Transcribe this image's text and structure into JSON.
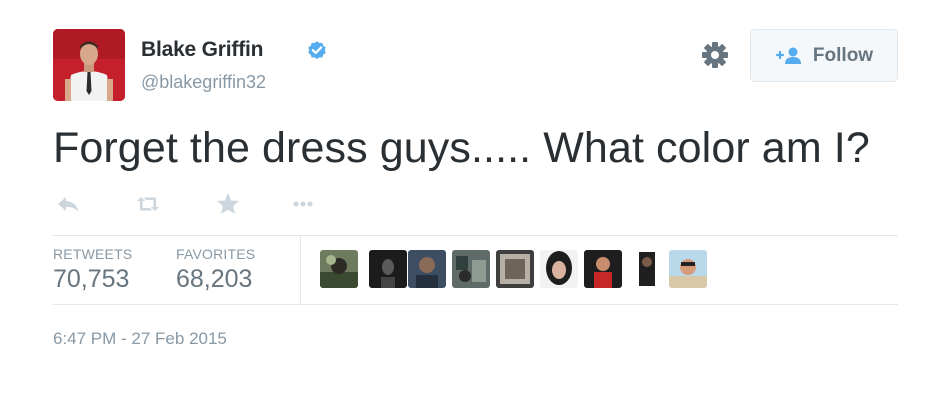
{
  "author": {
    "display_name": "Blake Griffin",
    "handle": "@blakegriffin32",
    "verified": true
  },
  "header": {
    "follow_label": "Follow",
    "settings_icon": "gear-icon"
  },
  "tweet": {
    "text": "Forget the dress guys..... What color am I?"
  },
  "actions": [
    "reply-icon",
    "retweet-icon",
    "favorite-icon",
    "more-icon"
  ],
  "stats": {
    "retweets_label": "RETWEETS",
    "retweets_value": "70,753",
    "favorites_label": "FAVORITES",
    "favorites_value": "68,203"
  },
  "favoriters": [
    "avatar-1",
    "avatar-2",
    "avatar-3",
    "avatar-4",
    "avatar-5",
    "avatar-6",
    "avatar-7",
    "avatar-8",
    "avatar-9"
  ],
  "timestamp": "6:47 PM - 27 Feb 2015",
  "colors": {
    "verified_blue": "#55acee",
    "muted_text": "#8899a6",
    "stat_value": "#66757f",
    "avatar_bg": "#c4202c"
  }
}
